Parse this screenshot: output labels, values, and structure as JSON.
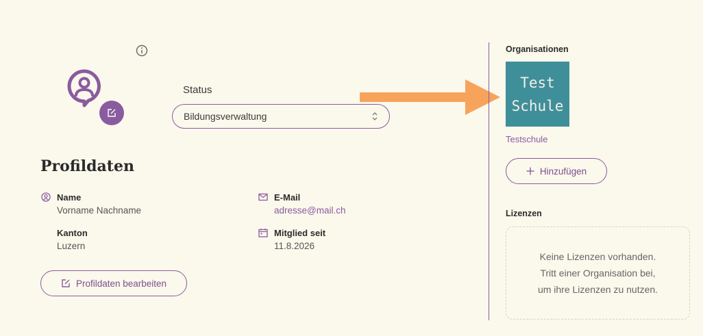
{
  "profile": {
    "status_label": "Status",
    "status_value": "Bildungsverwaltung",
    "title": "Profildaten",
    "fields": {
      "name_label": "Name",
      "name_value": "Vorname Nachname",
      "kanton_label": "Kanton",
      "kanton_value": "Luzern",
      "email_label": "E-Mail",
      "email_value": "adresse@mail.ch",
      "member_label": "Mitglied seit",
      "member_value": "11.8.2026"
    },
    "edit_button_label": "Profildaten bearbeiten"
  },
  "organisations": {
    "heading": "Organisationen",
    "logo_line1": "Test",
    "logo_line2": "Schule",
    "org_name": "Testschule",
    "add_button_label": "Hinzufügen"
  },
  "licenses": {
    "heading": "Lizenzen",
    "empty_line1": "Keine Lizenzen vorhanden.",
    "empty_line2": "Tritt einer Organisation bei,",
    "empty_line3": "um ihre Lizenzen zu nutzen."
  },
  "colors": {
    "background": "#fbf8ec",
    "accent": "#8a5b9f",
    "arrow": "#f7a35c",
    "logo_bg": "#3f8f9a"
  }
}
